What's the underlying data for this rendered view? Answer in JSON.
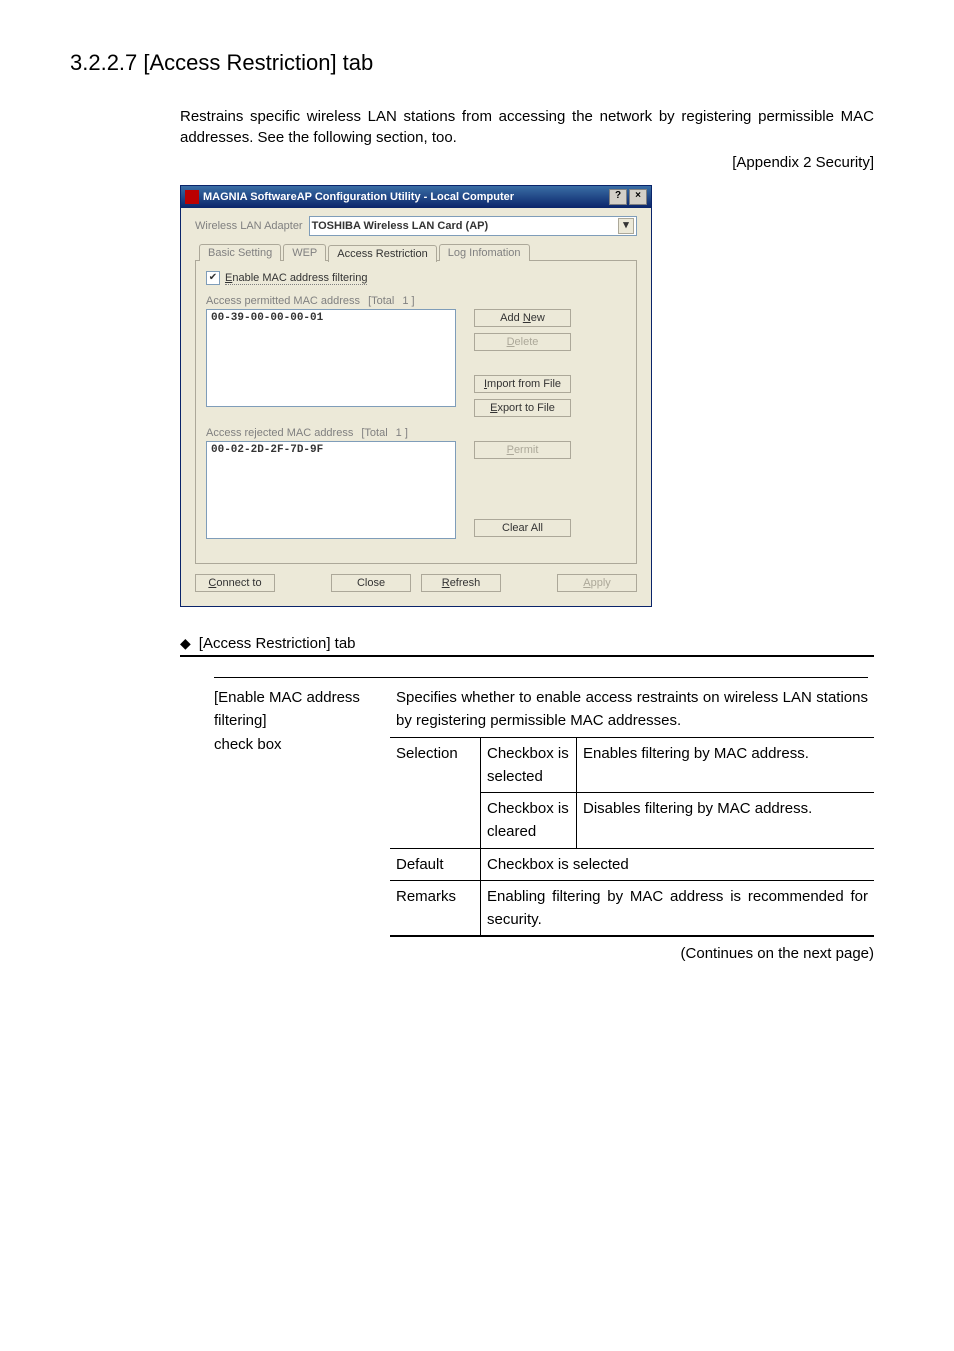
{
  "heading": "3.2.2.7 [Access Restriction] tab",
  "intro": "Restrains specific wireless LAN stations from accessing the network by registering permissible MAC addresses. See the following section, too.",
  "appendix_ref": "[Appendix 2  Security]",
  "dialog": {
    "title": "MAGNIA SoftwareAP Configuration Utility - Local Computer",
    "help_btn": "?",
    "close_btn": "×",
    "adapter_label": "Wireless LAN Adapter",
    "adapter_value": "TOSHIBA Wireless LAN Card (AP)",
    "tabs": {
      "basic": "Basic Setting",
      "wep": "WEP",
      "access": "Access Restriction",
      "log": "Log Infomation"
    },
    "enable_label_pre": "E",
    "enable_label": "nable MAC address filtering",
    "permitted_label": "Access permitted MAC address",
    "permitted_total_label": "[Total",
    "permitted_total_count": "1 ]",
    "permitted_entry": "00-39-00-00-00-01",
    "rejected_label": "Access rejected MAC address",
    "rejected_total_label": "[Total",
    "rejected_total_count": "1 ]",
    "rejected_entry": "00-02-2D-2F-7D-9F",
    "buttons": {
      "add_new_pre": "Add ",
      "add_new_ul": "N",
      "add_new_post": "ew",
      "delete_ul": "D",
      "delete_post": "elete",
      "import_ul": "I",
      "import_post": "mport from File",
      "export_ul": "E",
      "export_post": "xport to File",
      "permit_ul": "P",
      "permit_post": "ermit",
      "clear_all": "Clear All",
      "connect_ul": "C",
      "connect_post": "onnect to",
      "close": "Close",
      "refresh_ul": "R",
      "refresh_post": "efresh",
      "apply_ul": "A",
      "apply_post": "pply"
    }
  },
  "table": {
    "bullet_title": "[Access Restriction] tab",
    "name_line1": "[Enable MAC address",
    "name_line2": "filtering]",
    "name_line3": "check box",
    "desc": "Specifies whether to enable access restraints on wireless LAN stations by registering permissible MAC addresses.",
    "selection": "Selection",
    "sel_on_state": "Checkbox is selected",
    "sel_on_desc": "Enables filtering by MAC address.",
    "sel_off_state": "Checkbox is cleared",
    "sel_off_desc": "Disables filtering by MAC address.",
    "default_label": "Default",
    "default_value": "Checkbox is selected",
    "remarks_label": "Remarks",
    "remarks_value": "Enabling filtering by MAC address is recommended for security."
  },
  "continues": "(Continues on the next page)"
}
